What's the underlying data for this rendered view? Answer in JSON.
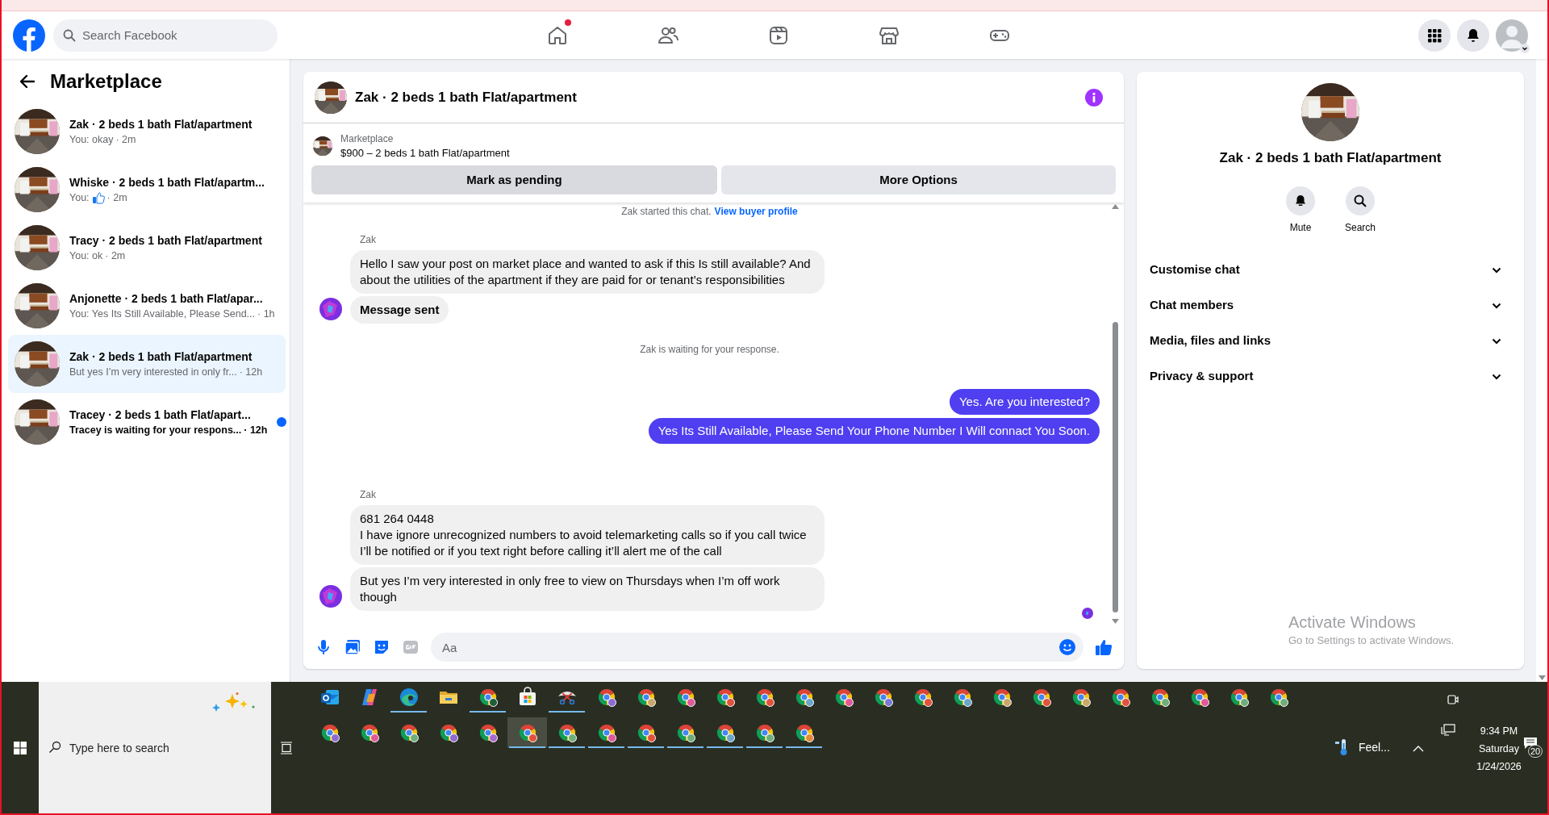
{
  "nav": {
    "search_placeholder": "Search Facebook",
    "tabs": [
      {
        "kind": "home",
        "selected": false,
        "badge": true
      },
      {
        "kind": "friends",
        "selected": false,
        "badge": false
      },
      {
        "kind": "video",
        "selected": false,
        "badge": false
      },
      {
        "kind": "marketplace",
        "selected": false,
        "badge": false
      },
      {
        "kind": "gaming",
        "selected": false,
        "badge": false
      }
    ]
  },
  "sidebar": {
    "title": "Marketplace",
    "conversations": [
      {
        "title": "Zak · 2 beds 1 bath Flat/apartment",
        "kind": "text",
        "preview": "You: okay",
        "time": "· 2m",
        "unread": false,
        "selected": false
      },
      {
        "title": "Whiske · 2 beds 1 bath Flat/apartm...",
        "kind": "sticker",
        "preview": "You:",
        "time": "· 2m",
        "unread": false,
        "selected": false
      },
      {
        "title": "Tracy · 2 beds 1 bath Flat/apartment",
        "kind": "text",
        "preview": "You: ok",
        "time": "· 2m",
        "unread": false,
        "selected": false
      },
      {
        "title": "Anjonette · 2 beds 1 bath Flat/apar...",
        "kind": "text",
        "preview": "You: Yes Its Still Available, Please Send...",
        "time": "· 1h",
        "unread": false,
        "selected": false
      },
      {
        "title": "Zak · 2 beds 1 bath Flat/apartment",
        "kind": "text",
        "preview": "But yes I’m very interested in only fr...",
        "time": "· 12h",
        "unread": false,
        "selected": true
      },
      {
        "title": "Tracey · 2 beds 1 bath Flat/apart...",
        "kind": "text",
        "preview": "Tracey is waiting for your respons...",
        "time": "· 12h",
        "unread": true,
        "selected": false
      }
    ]
  },
  "chat": {
    "title": "Zak · 2 beds 1 bath Flat/apartment",
    "listing": {
      "label": "Marketplace",
      "summary": "$900 – 2 beds 1 bath Flat/apartment"
    },
    "actions": [
      {
        "label": "Mark as pending",
        "hovered": true
      },
      {
        "label": "More Options",
        "hovered": false
      }
    ],
    "intro": {
      "text": "Zak started this chat.",
      "link": "View buyer profile"
    },
    "messages": [
      {
        "kind": "sender",
        "text": "Zak"
      },
      {
        "kind": "incoming",
        "text": "Hello I saw your post on market place and wanted to ask if this Is still available? And about the utilities of the apartment if they are paid for or tenant’s responsibilities",
        "bold": false,
        "avatar": false
      },
      {
        "kind": "incoming",
        "text": "Message sent",
        "bold": true,
        "avatar": true
      },
      {
        "kind": "notice",
        "text": "Zak is waiting for your response."
      },
      {
        "kind": "outgoing",
        "text": "Yes. Are you interested?"
      },
      {
        "kind": "outgoing",
        "text": "Yes Its Still Available, Please Send Your Phone Number I Will connact You Soon."
      },
      {
        "kind": "sender",
        "text": "Zak"
      },
      {
        "kind": "incoming",
        "text": "681 264 0448\nI have ignore unrecognized numbers to avoid telemarketing calls so if you call twice I’ll be notified or if you text right before calling it’ll alert me of the call",
        "bold": false,
        "avatar": false
      },
      {
        "kind": "incoming",
        "text": "But yes I’m very interested in only free to view on Thursdays when I’m off work though",
        "bold": false,
        "avatar": true
      }
    ],
    "composer_placeholder": "Aa"
  },
  "details": {
    "title": "Zak · 2 beds 1 bath Flat/apartment",
    "actions": [
      {
        "kind": "mute",
        "label": "Mute"
      },
      {
        "kind": "search",
        "label": "Search"
      }
    ],
    "sections": [
      {
        "label": "Customise chat",
        "expanded": false
      },
      {
        "label": "Chat members",
        "expanded": false
      },
      {
        "label": "Media, files and links",
        "expanded": false
      },
      {
        "label": "Privacy & support",
        "expanded": false
      }
    ]
  },
  "activation_notice": {
    "title": "Activate Windows",
    "text": "Go to Settings to activate Windows."
  },
  "taskbar": {
    "search_placeholder": "Type here to search",
    "row_1": [
      {
        "kind": "mail",
        "running": false,
        "selected": false
      },
      {
        "kind": "assistant",
        "running": false,
        "selected": false
      },
      {
        "kind": "edge",
        "running": true,
        "selected": false
      },
      {
        "kind": "folder",
        "running": false,
        "selected": false
      },
      {
        "kind": "browser",
        "color": "#1f5f3a",
        "running": true,
        "selected": false
      },
      {
        "kind": "store",
        "running": false,
        "selected": false
      },
      {
        "kind": "scissors",
        "running": true,
        "selected": false
      },
      {
        "kind": "browser",
        "color": "#8e6bd1",
        "running": false,
        "selected": false
      },
      {
        "kind": "browser",
        "color": "#c9a86a",
        "running": false,
        "selected": false
      },
      {
        "kind": "browser",
        "color": "#e05a9a",
        "running": false,
        "selected": false
      },
      {
        "kind": "browser",
        "color": "#e0533f",
        "running": false,
        "selected": false
      },
      {
        "kind": "browser",
        "color": "#e0533f",
        "running": false,
        "selected": false
      },
      {
        "kind": "browser",
        "color": "#6aa6c9",
        "running": false,
        "selected": false
      },
      {
        "kind": "browser",
        "color": "#e05a9a",
        "running": false,
        "selected": false
      },
      {
        "kind": "browser",
        "color": "#7a7ad8",
        "running": false,
        "selected": false
      },
      {
        "kind": "browser",
        "color": "#e0533f",
        "running": false,
        "selected": false
      },
      {
        "kind": "browser",
        "color": "#6aa6c9",
        "running": false,
        "selected": false
      },
      {
        "kind": "browser",
        "color": "#c9a86a",
        "running": false,
        "selected": false
      },
      {
        "kind": "browser",
        "color": "#e0533f",
        "running": false,
        "selected": false
      },
      {
        "kind": "browser",
        "color": "#c9a86a",
        "running": false,
        "selected": false
      },
      {
        "kind": "browser",
        "color": "#e0533f",
        "running": false,
        "selected": false
      },
      {
        "kind": "browser",
        "color": "#6fae7a",
        "running": false,
        "selected": false
      },
      {
        "kind": "browser",
        "color": "#e05a9a",
        "running": false,
        "selected": false
      },
      {
        "kind": "browser",
        "color": "#6fae7a",
        "running": false,
        "selected": false
      },
      {
        "kind": "browser",
        "color": "#6fae7a",
        "running": false,
        "selected": false
      }
    ],
    "row_2": [
      {
        "kind": "browser",
        "color": "#8e6bd1",
        "running": false,
        "selected": false
      },
      {
        "kind": "browser",
        "color": "#e05a9a",
        "running": false,
        "selected": false
      },
      {
        "kind": "browser",
        "color": "#6fae7a",
        "running": false,
        "selected": false
      },
      {
        "kind": "browser",
        "color": "#8e6bd1",
        "running": false,
        "selected": false
      },
      {
        "kind": "browser",
        "color": "#a66bd1",
        "running": false,
        "selected": false
      },
      {
        "kind": "browser",
        "color": "#e0533f",
        "running": true,
        "selected": true
      },
      {
        "kind": "browser",
        "color": "#6fae7a",
        "running": true,
        "selected": false
      },
      {
        "kind": "browser",
        "color": "#e05a9a",
        "running": true,
        "selected": false
      },
      {
        "kind": "browser",
        "color": "#e0533f",
        "running": true,
        "selected": false
      },
      {
        "kind": "browser",
        "color": "#6fae7a",
        "running": true,
        "selected": false
      },
      {
        "kind": "browser",
        "color": "#6aa6c9",
        "running": true,
        "selected": false
      },
      {
        "kind": "browser",
        "color": "#6fae7a",
        "running": true,
        "selected": false
      },
      {
        "kind": "browser",
        "color": "#e08a3f",
        "running": true,
        "selected": false
      }
    ],
    "tray": {
      "weather": "Feel...",
      "time": "9:34 PM",
      "day": "Saturday",
      "date": "1/24/2026",
      "notifications": "20"
    }
  }
}
